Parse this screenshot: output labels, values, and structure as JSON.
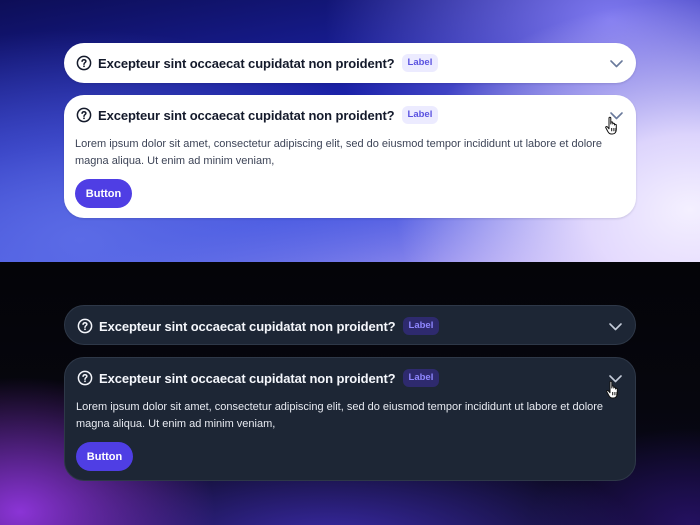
{
  "light": {
    "collapsed": {
      "title": "Excepteur sint occaecat cupidatat non proident?",
      "badge": "Label"
    },
    "expanded": {
      "title": "Excepteur sint occaecat cupidatat non proident?",
      "badge": "Label",
      "body": "Lorem ipsum dolor sit amet, consectetur adipiscing elit, sed do eiusmod tempor incididunt ut labore et dolore magna aliqua. Ut enim ad minim veniam,",
      "button": "Button"
    }
  },
  "dark": {
    "collapsed": {
      "title": "Excepteur sint occaecat cupidatat non proident?",
      "badge": "Label"
    },
    "expanded": {
      "title": "Excepteur sint occaecat cupidatat non proident?",
      "badge": "Label",
      "body": "Lorem ipsum dolor sit amet, consectetur adipiscing elit, sed do eiusmod tempor incididunt ut labore et dolore magna aliqua. Ut enim ad minim veniam,",
      "button": "Button"
    }
  },
  "icons": {
    "question": "question-circle-icon",
    "chevron": "chevron-down-icon",
    "cursor": "hand-pointer-icon"
  },
  "colors": {
    "accent": "#4f3ee4",
    "badge_light_bg": "#ecebff",
    "badge_light_text": "#5a52e0",
    "badge_dark_bg": "#2e2a6e",
    "badge_dark_text": "#8f87ff",
    "dark_card": "#1d2635"
  }
}
